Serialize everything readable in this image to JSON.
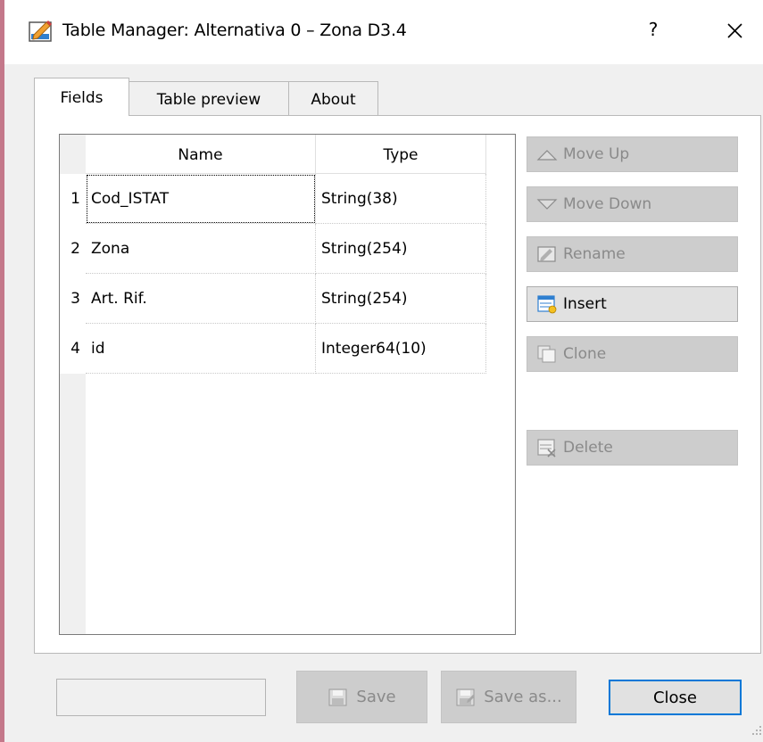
{
  "window": {
    "title": "Table Manager: Alternativa 0 – Zona D3.4",
    "help_label": "?"
  },
  "tabs": [
    {
      "label": "Fields",
      "active": true
    },
    {
      "label": "Table preview",
      "active": false
    },
    {
      "label": "About",
      "active": false
    }
  ],
  "table": {
    "columns": [
      "Name",
      "Type"
    ],
    "rows": [
      {
        "num": "1",
        "name": "Cod_ISTAT",
        "type": "String(38)"
      },
      {
        "num": "2",
        "name": "Zona",
        "type": "String(254)"
      },
      {
        "num": "3",
        "name": "Art. Rif.",
        "type": "String(254)"
      },
      {
        "num": "4",
        "name": "id",
        "type": "Integer64(10)"
      }
    ]
  },
  "side_buttons": {
    "move_up": "Move Up",
    "move_down": "Move Down",
    "rename": "Rename",
    "insert": "Insert",
    "clone": "Clone",
    "delete": "Delete"
  },
  "bottom": {
    "status_value": "",
    "save": "Save",
    "save_as": "Save as...",
    "close": "Close"
  },
  "colors": {
    "accent_focus": "#0078d7",
    "disabled_button": "#cdcdcd",
    "window_bg": "#f0f0f0"
  }
}
